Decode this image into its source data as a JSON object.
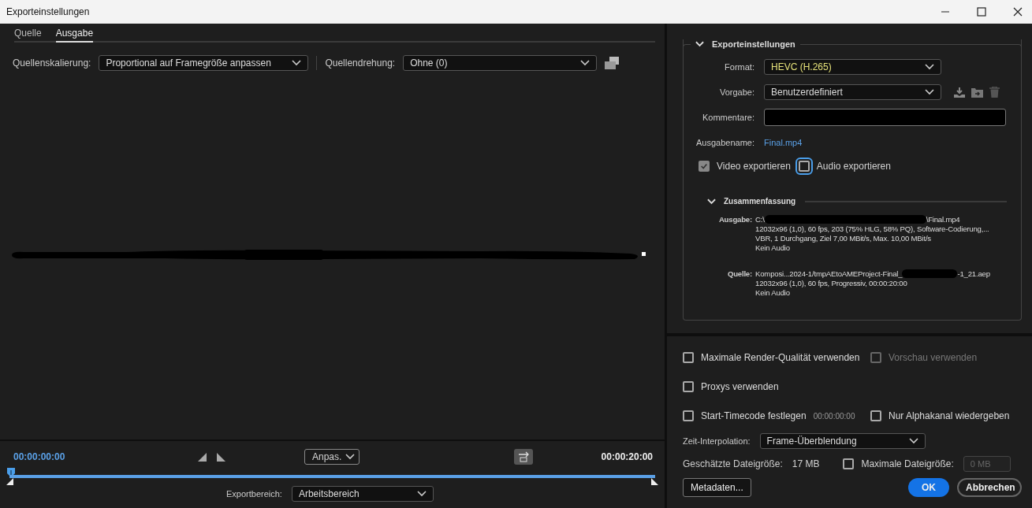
{
  "window": {
    "title": "Exporteinstellungen"
  },
  "source_tabs": [
    {
      "label": "Quelle",
      "selected": false
    },
    {
      "label": "Ausgabe",
      "selected": true
    }
  ],
  "source_scaling": {
    "label": "Quellenskalierung:",
    "value": "Proportional auf Framegröße anpassen"
  },
  "source_rotation": {
    "label": "Quellendrehung:",
    "value": "Ohne (0)"
  },
  "timeline": {
    "current_time": "00:00:00:00",
    "zoom": "Anpas.",
    "end_time": "00:00:20:00",
    "export_range": {
      "label": "Exportbereich:",
      "value": "Arbeitsbereich"
    }
  },
  "export_settings": {
    "title": "Exporteinstellungen",
    "expanded": true,
    "format": {
      "label": "Format:",
      "value": "HEVC (H.265)"
    },
    "preset": {
      "label": "Vorgabe:",
      "value": "Benutzerdefiniert"
    },
    "comments": {
      "label": "Kommentare:"
    },
    "output_name": {
      "label": "Ausgabename:",
      "value": "Final.mp4"
    },
    "export_video": {
      "label": "Video exportieren",
      "checked": true,
      "disabled": true
    },
    "export_audio": {
      "label": "Audio exportieren",
      "checked": false,
      "focused": true
    },
    "summary": {
      "title": "Zusammenfassung",
      "expanded": true,
      "output": {
        "label": "Ausgabe:",
        "path_start": "C:\\",
        "path_end": "\\Final.mp4",
        "lines": [
          "12032x96 (1,0), 60 fps, 203 (75% HLG, 58% PQ), Software-Codierung,...",
          "VBR, 1 Durchgang, Ziel 7,00 MBit/s, Max. 10,00 MBit/s",
          "Kein Audio"
        ]
      },
      "source": {
        "label": "Quelle:",
        "path_start": "Komposi...2024-1/tmpAEtoAMEProject-Final_",
        "path_end": "-1_21.aep",
        "lines": [
          "12032x96 (1,0), 60 fps, Progressiv, 00:00:20:00",
          "Kein Audio"
        ]
      }
    }
  },
  "options": [
    {
      "label": "Maximale Render-Qualität verwenden",
      "checked": false,
      "disabled": false
    },
    {
      "label": "Vorschau verwenden",
      "checked": false,
      "disabled": true
    },
    {
      "label": "Proxys verwenden",
      "checked": false,
      "disabled": false
    },
    {
      "label": "Start-Timecode festlegen",
      "checked": false,
      "disabled": false,
      "timecode": "00:00:00:00"
    },
    {
      "label": "Nur Alphakanal wiedergeben",
      "checked": false,
      "disabled": false
    }
  ],
  "time_interpolation": {
    "label": "Zeit-Interpolation:",
    "value": "Frame-Überblendung"
  },
  "estimated_size": {
    "label": "Geschätzte Dateigröße:",
    "value": "17 MB"
  },
  "max_file_size": {
    "label": "Maximale Dateigröße:",
    "checked": false,
    "value": "0 MB"
  },
  "buttons": {
    "metadata": "Metadaten...",
    "ok": "OK",
    "cancel": "Abbrechen"
  }
}
